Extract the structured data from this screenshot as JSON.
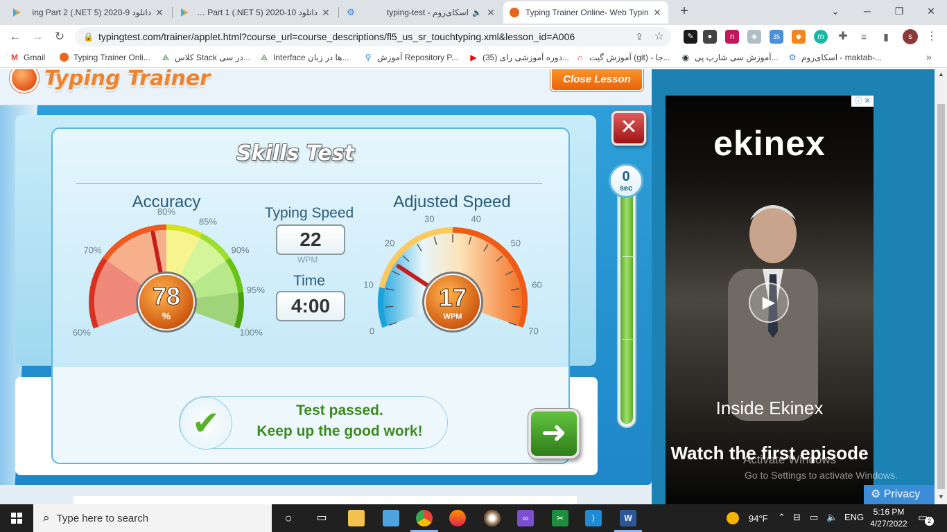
{
  "browser": {
    "tabs": [
      {
        "title": "دانلود 9-2020 (NET 5.) ing Part 2",
        "icon": "play-icon",
        "active": false
      },
      {
        "title": "دانلود 10-2020 (NET 5.) ing Part 1",
        "icon": "play-icon",
        "active": false
      },
      {
        "title": "اسکای‌روم - typing-test",
        "icon": "skyroom-icon",
        "active": false
      },
      {
        "title": "Typing Trainer Online- Web Typin",
        "icon": "typing-trainer-icon",
        "active": true
      }
    ],
    "new_tab": "+",
    "url": "typingtest.com/trainer/applet.html?course_url=course_descriptions/fl5_us_sr_touchtyping.xml&lesson_id=A006",
    "extension_badge": "35",
    "profile_initial": "s"
  },
  "bookmarks": [
    {
      "label": "Gmail",
      "icon": "gmail-icon"
    },
    {
      "label": "Typing Trainer Onli...",
      "icon": "typing-trainer-icon"
    },
    {
      "label": "کلاس Stack در سی...",
      "icon": "codelike-icon"
    },
    {
      "label": "Interface ها در زبان...",
      "icon": "codelike-icon"
    },
    {
      "label": "آموزش Repository P...",
      "icon": "location-icon"
    },
    {
      "label": "(35) دوره آموزشی رای...",
      "icon": "youtube-icon"
    },
    {
      "label": "آموزش گیت (git) - جا...",
      "icon": "magnet-icon"
    },
    {
      "label": "آموزش سی شارپ پی...",
      "icon": "globe-icon"
    },
    {
      "label": "اسکای‌روم - maktab-...",
      "icon": "skyroom-icon"
    }
  ],
  "trainer": {
    "logo_text": "Typing Trainer",
    "close_lesson": "Close Lesson",
    "skills_title": "Skills Test",
    "accuracy": {
      "label": "Accuracy",
      "value": "78",
      "unit": "%",
      "ticks": [
        "60%",
        "70%",
        "80%",
        "85%",
        "90%",
        "95%",
        "100%"
      ],
      "needle_value": 78
    },
    "typing_speed": {
      "label": "Typing Speed",
      "value": "22",
      "unit": "WPM"
    },
    "time": {
      "label": "Time",
      "value": "4:00"
    },
    "adjusted_speed": {
      "label": "Adjusted Speed",
      "value": "17",
      "unit": "WPM",
      "ticks": [
        "0",
        "10",
        "20",
        "30",
        "40",
        "50",
        "60",
        "70"
      ],
      "needle_value": 17
    },
    "timer": {
      "value": "0",
      "unit": "sec"
    },
    "result_line1": "Test passed.",
    "result_line2": "Keep up the good work!"
  },
  "ad": {
    "brand": "ekinex",
    "headline": "Inside Ekinex",
    "cta": "Watch the first episode",
    "privacy": "Privacy"
  },
  "watermark": {
    "line1": "Activate Windows",
    "line2": "Go to Settings to activate Windows."
  },
  "taskbar": {
    "search_placeholder": "Type here to search",
    "temperature": "94°F",
    "language": "ENG",
    "time": "5:16 PM",
    "date": "4/27/2022",
    "notification_count": "2"
  },
  "colors": {
    "accent_orange": "#f2822a",
    "trainer_blue": "#1e87c8",
    "pass_green": "#3b8a1f"
  }
}
